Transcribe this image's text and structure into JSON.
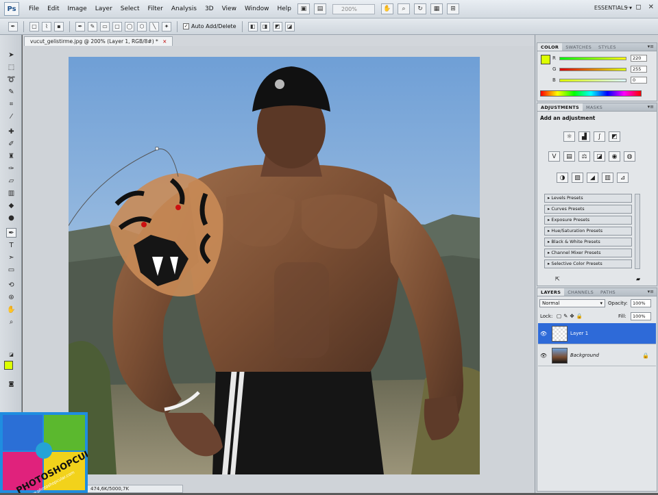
{
  "menubar": {
    "logo": "Ps",
    "items": [
      "File",
      "Edit",
      "Image",
      "Layer",
      "Select",
      "Filter",
      "Analysis",
      "3D",
      "View",
      "Window",
      "Help"
    ],
    "zoom": "200%",
    "workspace": "ESSENTIALS",
    "win_controls": [
      "–",
      "◻",
      "✕"
    ]
  },
  "options": {
    "auto_add_delete": "Auto Add/Delete",
    "auto_add_checked": "✓"
  },
  "document": {
    "tab_title": "vucut_gelistirme.jpg @ 200% (Layer 1, RGB/8#) *",
    "tab_close": "×",
    "status": "474,6K/5000,7K"
  },
  "watermark": {
    "line1": "PHOTOSHOPCULAR",
    "line2": "www.photoshopcular.com"
  },
  "color_panel": {
    "tabs": [
      "COLOR",
      "SWATCHES",
      "STYLES"
    ],
    "channels": [
      {
        "label": "R",
        "value": "220"
      },
      {
        "label": "G",
        "value": "255"
      },
      {
        "label": "B",
        "value": "0"
      }
    ],
    "foreground": "#dcff00"
  },
  "adjustments_panel": {
    "tabs": [
      "ADJUSTMENTS",
      "MASKS"
    ],
    "heading": "Add an adjustment",
    "presets": [
      "Levels Presets",
      "Curves Presets",
      "Exposure Presets",
      "Hue/Saturation Presets",
      "Black & White Presets",
      "Channel Mixer Presets",
      "Selective Color Presets"
    ]
  },
  "layers_panel": {
    "tabs": [
      "LAYERS",
      "CHANNELS",
      "PATHS"
    ],
    "blend_mode": "Normal",
    "opacity_label": "Opacity:",
    "opacity": "100%",
    "lock_label": "Lock:",
    "fill_label": "Fill:",
    "fill": "100%",
    "layers": [
      {
        "name": "Layer 1",
        "selected": true
      },
      {
        "name": "Background",
        "selected": false
      }
    ]
  },
  "colors": {
    "selection": "#2e6ad8",
    "foreground": "#dcff00"
  }
}
